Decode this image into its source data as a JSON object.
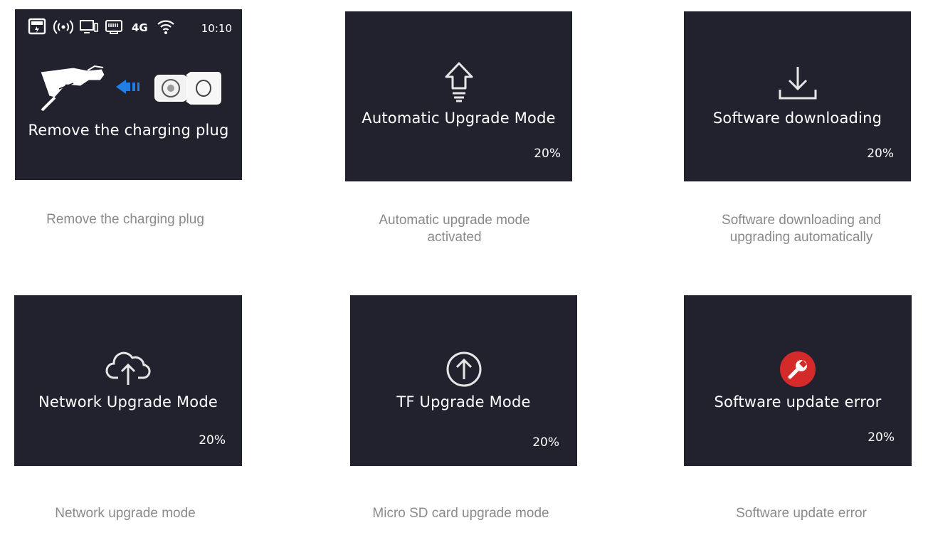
{
  "panels": [
    {
      "screen_title": "Remove the charging plug",
      "caption": "Remove the charging plug",
      "status_bar": {
        "network": "4G",
        "time": "10:10"
      }
    },
    {
      "screen_title": "Automatic Upgrade Mode",
      "percent": "20%",
      "caption_line1": "Automatic upgrade mode",
      "caption_line2": "activated",
      "icon": "upload-arrow-icon"
    },
    {
      "screen_title": "Software downloading",
      "percent": "20%",
      "caption_line1": "Software downloading and",
      "caption_line2": "upgrading automatically",
      "icon": "download-icon"
    },
    {
      "screen_title": "Network Upgrade Mode",
      "percent": "20%",
      "caption": "Network upgrade mode",
      "icon": "cloud-upload-icon"
    },
    {
      "screen_title": "TF Upgrade Mode",
      "percent": "20%",
      "caption": "Micro SD card upgrade mode",
      "icon": "circle-arrow-up-icon"
    },
    {
      "screen_title": "Software update error",
      "percent": "20%",
      "caption": "Software update error",
      "icon": "wrench-error-icon",
      "error_color": "#d42a2a"
    }
  ],
  "colors": {
    "screen_bg": "#22222f",
    "caption": "#8a8a8a",
    "accent_blue": "#1f7fe6"
  }
}
